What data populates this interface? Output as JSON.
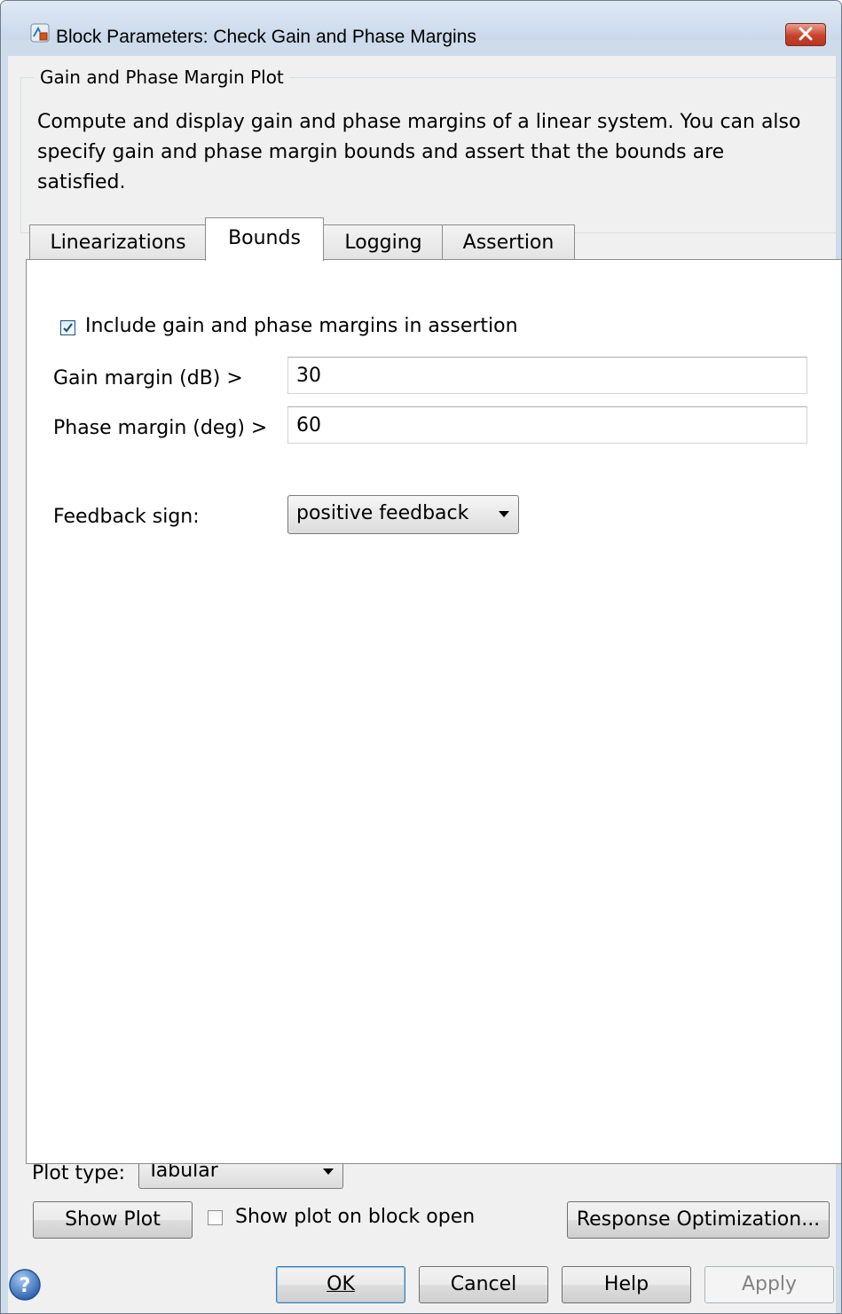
{
  "window": {
    "title": "Block Parameters: Check Gain and Phase Margins",
    "close_icon": "close-icon"
  },
  "group": {
    "title": "Gain and Phase Margin Plot",
    "description": "Compute and display gain and phase margins of a linear system. You can also specify gain and phase margin bounds and assert that the bounds are satisfied."
  },
  "tabs": [
    {
      "label": "Linearizations",
      "active": false
    },
    {
      "label": "Bounds",
      "active": true
    },
    {
      "label": "Logging",
      "active": false
    },
    {
      "label": "Assertion",
      "active": false
    }
  ],
  "bounds": {
    "include_checkbox": {
      "label": "Include gain and phase margins in assertion",
      "checked": true
    },
    "gain_margin": {
      "label": "Gain margin (dB) >",
      "value": "30"
    },
    "phase_margin": {
      "label": "Phase margin (deg) >",
      "value": "60"
    },
    "feedback_sign": {
      "label": "Feedback sign:",
      "selected": "positive feedback"
    }
  },
  "plot": {
    "type_label": "Plot type:",
    "type_selected": "Tabular",
    "show_plot_label": "Show Plot",
    "show_on_open": {
      "label": "Show plot on block open",
      "checked": false
    },
    "response_optimization_label": "Response Optimization..."
  },
  "footer": {
    "ok_label": "OK",
    "cancel_label": "Cancel",
    "help_label": "Help",
    "apply_label": "Apply",
    "apply_enabled": false
  },
  "colors": {
    "frame": "#cddbea",
    "client": "#f0f0f0",
    "close_button": "#c9422b",
    "default_button_border": "#3c7fb1",
    "checkbox_tick": "#1c5180"
  }
}
